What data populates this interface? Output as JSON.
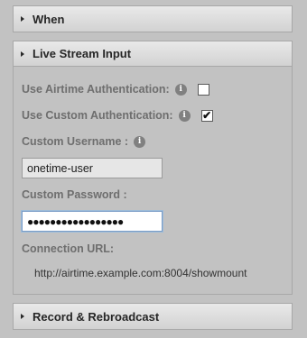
{
  "panels": {
    "when": {
      "title": "When"
    },
    "live": {
      "title": "Live Stream Input",
      "airtime_auth": {
        "label": "Use Airtime Authentication:",
        "checked": false
      },
      "custom_auth": {
        "label": "Use Custom Authentication:",
        "checked": true,
        "check_glyph": "✔"
      },
      "username": {
        "label": "Custom Username :",
        "value": "onetime-user"
      },
      "password": {
        "label": "Custom Password :",
        "masked": "●●●●●●●●●●●●●●●●●"
      },
      "connection": {
        "label": "Connection URL:",
        "url": "http://airtime.example.com:8004/showmount"
      }
    },
    "record": {
      "title": "Record & Rebroadcast"
    }
  },
  "icons": {
    "info": "info-icon",
    "expand": "triangle-right-icon"
  }
}
